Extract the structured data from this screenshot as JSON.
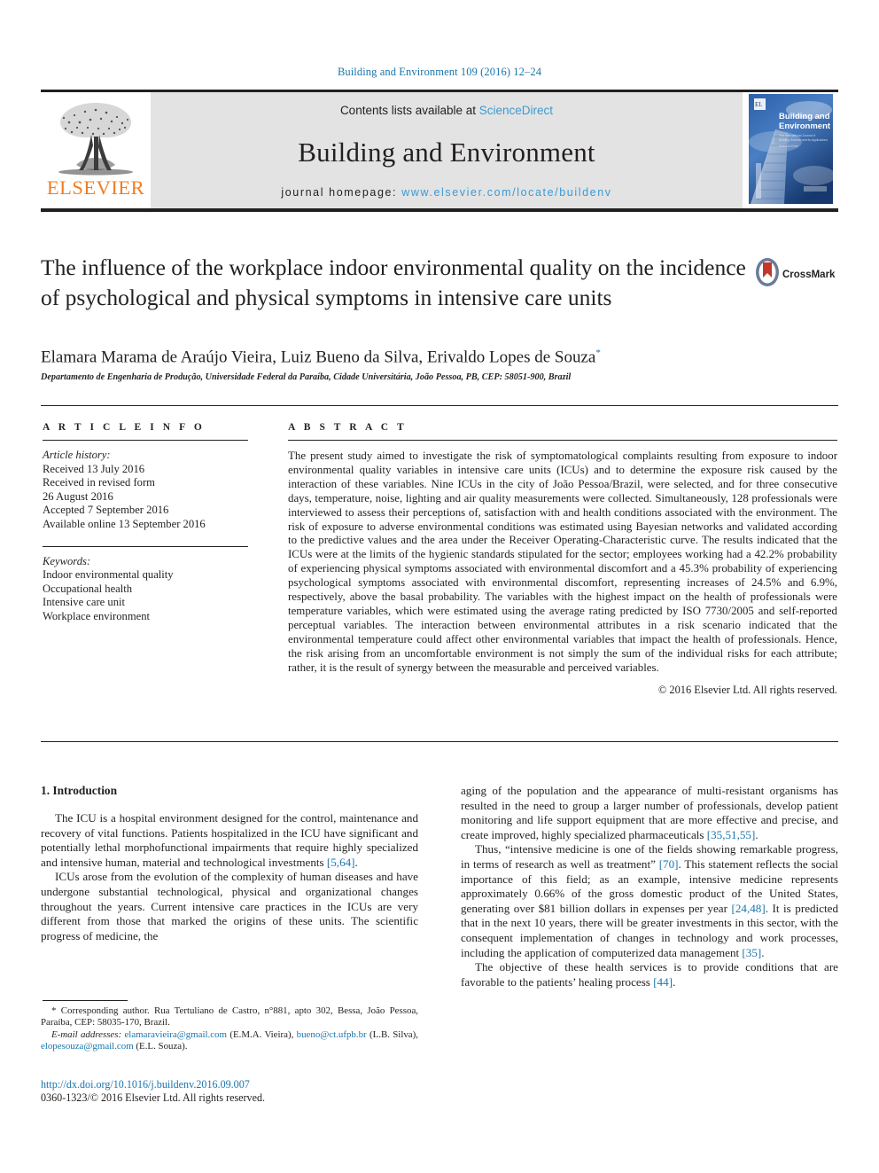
{
  "running_head": "Building and Environment 109 (2016) 12–24",
  "masthead": {
    "contents_prefix": "Contents lists available at ",
    "sciencedirect": "ScienceDirect",
    "journal_name": "Building and Environment",
    "homepage_prefix": "journal homepage: ",
    "homepage_url": "www.elsevier.com/locate/buildenv",
    "publisher": "ELSEVIER",
    "cover_title_line1": "Building and",
    "cover_title_line2": "Environment"
  },
  "article": {
    "title": "The influence of the workplace indoor environmental quality on the incidence of psychological and physical symptoms in intensive care units",
    "crossmark_label": "CrossMark",
    "authors": "Elamara Marama de Araújo Vieira, Luiz Bueno da Silva, Erivaldo Lopes de Souza",
    "corresponding_marker": "*",
    "affiliation": "Departamento de Engenharia de Produção, Universidade Federal da Paraíba, Cidade Universitária, João Pessoa, PB, CEP: 58051-900, Brazil"
  },
  "article_info": {
    "heading": "A R T I C L E  I N F O",
    "history_label": "Article history:",
    "history": [
      "Received 13 July 2016",
      "Received in revised form",
      "26 August 2016",
      "Accepted 7 September 2016",
      "Available online 13 September 2016"
    ],
    "keywords_label": "Keywords:",
    "keywords": [
      "Indoor environmental quality",
      "Occupational health",
      "Intensive care unit",
      "Workplace environment"
    ]
  },
  "abstract": {
    "heading": "A B S T R A C T",
    "text": "The present study aimed to investigate the risk of symptomatological complaints resulting from exposure to indoor environmental quality variables in intensive care units (ICUs) and to determine the exposure risk caused by the interaction of these variables. Nine ICUs in the city of João Pessoa/Brazil, were selected, and for three consecutive days, temperature, noise, lighting and air quality measurements were collected. Simultaneously, 128 professionals were interviewed to assess their perceptions of, satisfaction with and health conditions associated with the environment. The risk of exposure to adverse environmental conditions was estimated using Bayesian networks and validated according to the predictive values and the area under the Receiver Operating-Characteristic curve. The results indicated that the ICUs were at the limits of the hygienic standards stipulated for the sector; employees working had a 42.2% probability of experiencing physical symptoms associated with environmental discomfort and a 45.3% probability of experiencing psychological symptoms associated with environmental discomfort, representing increases of 24.5% and 6.9%, respectively, above the basal probability. The variables with the highest impact on the health of professionals were temperature variables, which were estimated using the average rating predicted by ISO 7730/2005 and self-reported perceptual variables. The interaction between environmental attributes in a risk scenario indicated that the environmental temperature could affect other environmental variables that impact the health of professionals. Hence, the risk arising from an uncomfortable environment is not simply the sum of the individual risks for each attribute; rather, it is the result of synergy between the measurable and perceived variables.",
    "copyright": "© 2016 Elsevier Ltd. All rights reserved."
  },
  "introduction": {
    "heading": "1. Introduction",
    "left_paragraph_1": "The ICU is a hospital environment designed for the control, maintenance and recovery of vital functions. Patients hospitalized in the ICU have significant and potentially lethal morphofunctional impairments that require highly specialized and intensive human, material and technological investments ",
    "left_paragraph_1_ref": "[5,64]",
    "left_paragraph_1_end": ".",
    "left_paragraph_2": "ICUs arose from the evolution of the complexity of human diseases and have undergone substantial technological, physical and organizational changes throughout the years. Current intensive care practices in the ICUs are very different from those that marked the origins of these units. The scientific progress of medicine, the",
    "right_paragraph_1": "aging of the population and the appearance of multi-resistant organisms has resulted in the need to group a larger number of professionals, develop patient monitoring and life support equipment that are more effective and precise, and create improved, highly specialized pharmaceuticals ",
    "right_paragraph_1_ref": "[35,51,55]",
    "right_paragraph_1_end": ".",
    "right_paragraph_2_a": "Thus, “intensive medicine is one of the fields showing remarkable progress, in terms of research as well as treatment” ",
    "right_paragraph_2_ref1": "[70]",
    "right_paragraph_2_b": ". This statement reflects the social importance of this field; as an example, intensive medicine represents approximately 0.66% of the gross domestic product of the United States, generating over $81 billion dollars in expenses per year ",
    "right_paragraph_2_ref2": "[24,48]",
    "right_paragraph_2_c": ". It is predicted that in the next 10 years, there will be greater investments in this sector, with the consequent implementation of changes in technology and work processes, including the application of computerized data management ",
    "right_paragraph_2_ref3": "[35]",
    "right_paragraph_2_d": ".",
    "right_paragraph_3_a": "The objective of these health services is to provide conditions that are favorable to the patients’ healing process ",
    "right_paragraph_3_ref": "[44]",
    "right_paragraph_3_b": "."
  },
  "footnotes": {
    "corresponding_marker": "*",
    "corresponding_text": " Corresponding author. Rua Tertuliano de Castro, n°881, apto 302, Bessa, João Pessoa, Paraíba, CEP: 58035-170, Brazil.",
    "email_label": "E-mail addresses:",
    "email_1": "elamaravieira@gmail.com",
    "email_1_owner": " (E.M.A. Vieira), ",
    "email_2": "bueno@ct.ufpb.br",
    "email_2_owner": " (L.B. Silva), ",
    "email_3": "elopesouza@gmail.com",
    "email_3_owner": " (E.L. Souza)."
  },
  "footer": {
    "doi": "http://dx.doi.org/10.1016/j.buildenv.2016.09.007",
    "issn_line": "0360-1323/© 2016 Elsevier Ltd. All rights reserved."
  }
}
